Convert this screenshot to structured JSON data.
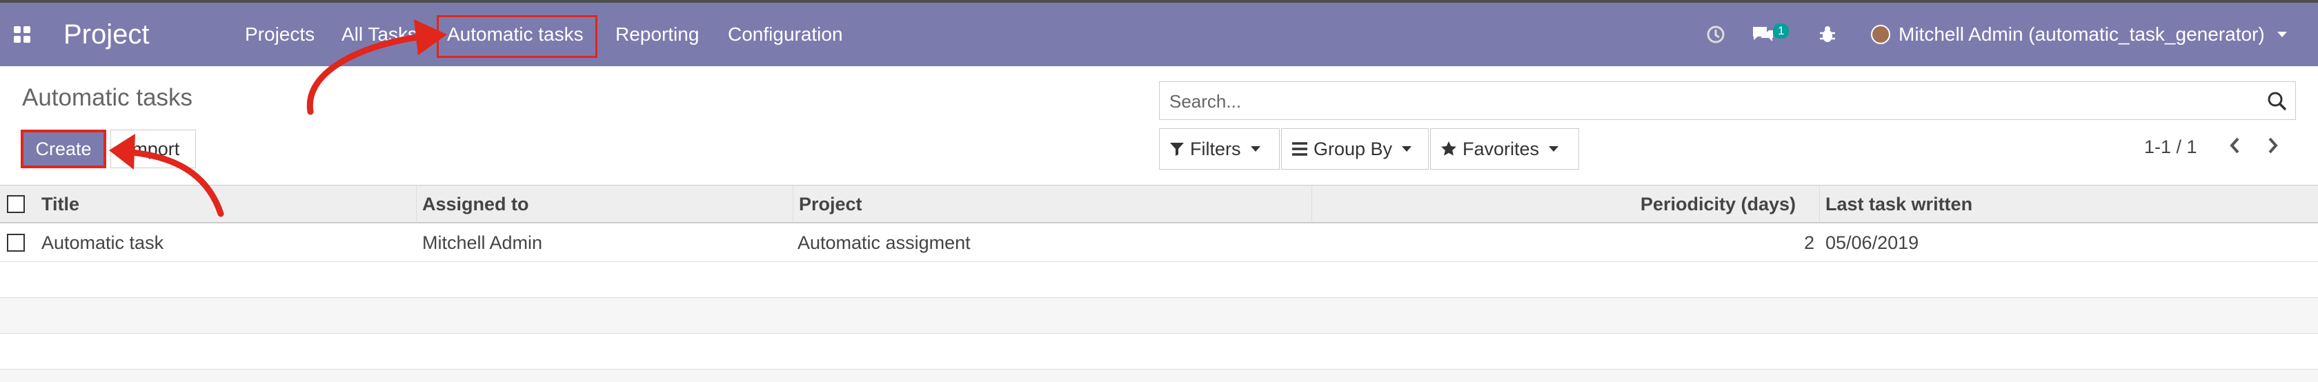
{
  "navbar": {
    "brand": "Project",
    "menu": [
      "Projects",
      "All Tasks",
      "Automatic tasks",
      "Reporting",
      "Configuration"
    ],
    "chat_count": "1",
    "user": "Mitchell Admin (automatic_task_generator)"
  },
  "page": {
    "title": "Automatic tasks",
    "create_label": "Create",
    "import_label": "Import",
    "search_placeholder": "Search...",
    "filters_label": "Filters",
    "groupby_label": "Group By",
    "favorites_label": "Favorites",
    "pager": "1-1 / 1"
  },
  "table": {
    "columns": [
      "Title",
      "Assigned to",
      "Project",
      "Periodicity (days)",
      "Last task written"
    ],
    "rows": [
      {
        "title": "Automatic task",
        "assigned": "Mitchell Admin",
        "project": "Automatic assigment",
        "periodicity": "2",
        "last": "05/06/2019"
      }
    ]
  },
  "colors": {
    "navbar": "#7c7bad",
    "annotation": "#e1261c"
  }
}
